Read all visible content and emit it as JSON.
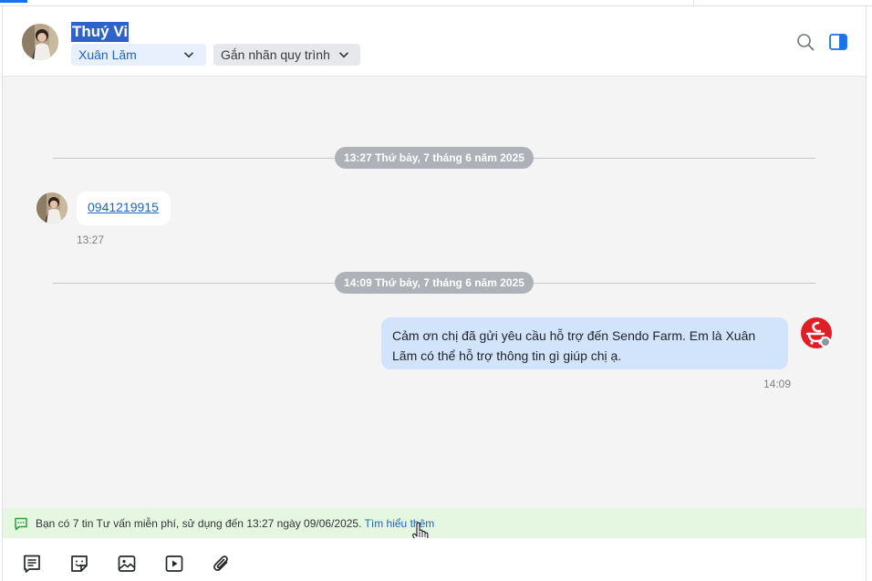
{
  "header": {
    "contact_name": "Thuý Vi",
    "assignee": "Xuân Lăm",
    "tag_placeholder": "Gắn nhãn quy trình"
  },
  "conversation": {
    "groups": [
      {
        "date_label": "13:27 Thứ bảy, 7 tháng 6 năm 2025",
        "message": {
          "direction": "incoming",
          "text": "0941219915",
          "time": "13:27"
        }
      },
      {
        "date_label": "14:09 Thứ bảy, 7 tháng 6 năm 2025",
        "message": {
          "direction": "outgoing",
          "text": "Cảm ơn chị đã gửi yêu cầu hỗ trợ đến Sendo Farm. Em là Xuân Lãm có thể hỗ trợ thông tin gì giúp chị ạ.",
          "time": "14:09"
        }
      }
    ]
  },
  "notice": {
    "text": "Bạn có 7 tin Tư vấn miễn phí, sử dụng đến 13:27 ngày 09/06/2025. ",
    "link": "Tìm hiểu thêm"
  },
  "toolbar": {
    "icons": [
      "quick-reply-icon",
      "sticker-icon",
      "image-icon",
      "video-icon",
      "attachment-icon"
    ]
  },
  "colors": {
    "accent": "#1e63c6",
    "outgoing_bubble": "#d2e3fc",
    "notice_bg": "#e6f7e1",
    "brand_red": "#e01e25"
  }
}
